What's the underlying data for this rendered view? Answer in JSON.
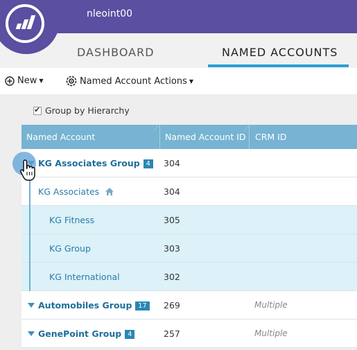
{
  "header": {
    "tenant": "nleoint00"
  },
  "tabs": [
    {
      "label": "DASHBOARD",
      "active": false
    },
    {
      "label": "NAMED ACCOUNTS",
      "active": true
    }
  ],
  "toolbar": {
    "new_label": "New",
    "actions_label": "Named Account Actions"
  },
  "options": {
    "group_by_hierarchy": "Group by Hierarchy",
    "group_by_hierarchy_checked": true
  },
  "grid": {
    "columns": [
      "Named Account",
      "Named Account ID",
      "CRM ID"
    ],
    "rows": [
      {
        "name": "KG Associates Group",
        "badge": "4",
        "id": "304",
        "crm": "",
        "level": "group"
      },
      {
        "name": "KG Associates",
        "id": "304",
        "crm": "",
        "level": "child-home"
      },
      {
        "name": "KG Fitness",
        "id": "305",
        "crm": "",
        "level": "child"
      },
      {
        "name": "KG Group",
        "id": "303",
        "crm": "",
        "level": "child"
      },
      {
        "name": "KG International",
        "id": "302",
        "crm": "",
        "level": "child"
      },
      {
        "name": "Automobiles Group",
        "badge": "17",
        "id": "269",
        "crm": "Multiple",
        "level": "group"
      },
      {
        "name": "GenePoint Group",
        "badge": "4",
        "id": "257",
        "crm": "Multiple",
        "level": "group"
      }
    ]
  },
  "colors": {
    "brand": "#5a4fa0",
    "accent": "#2a9fd6",
    "header_row": "#77b3d2",
    "child_row": "#dcf1f8"
  }
}
